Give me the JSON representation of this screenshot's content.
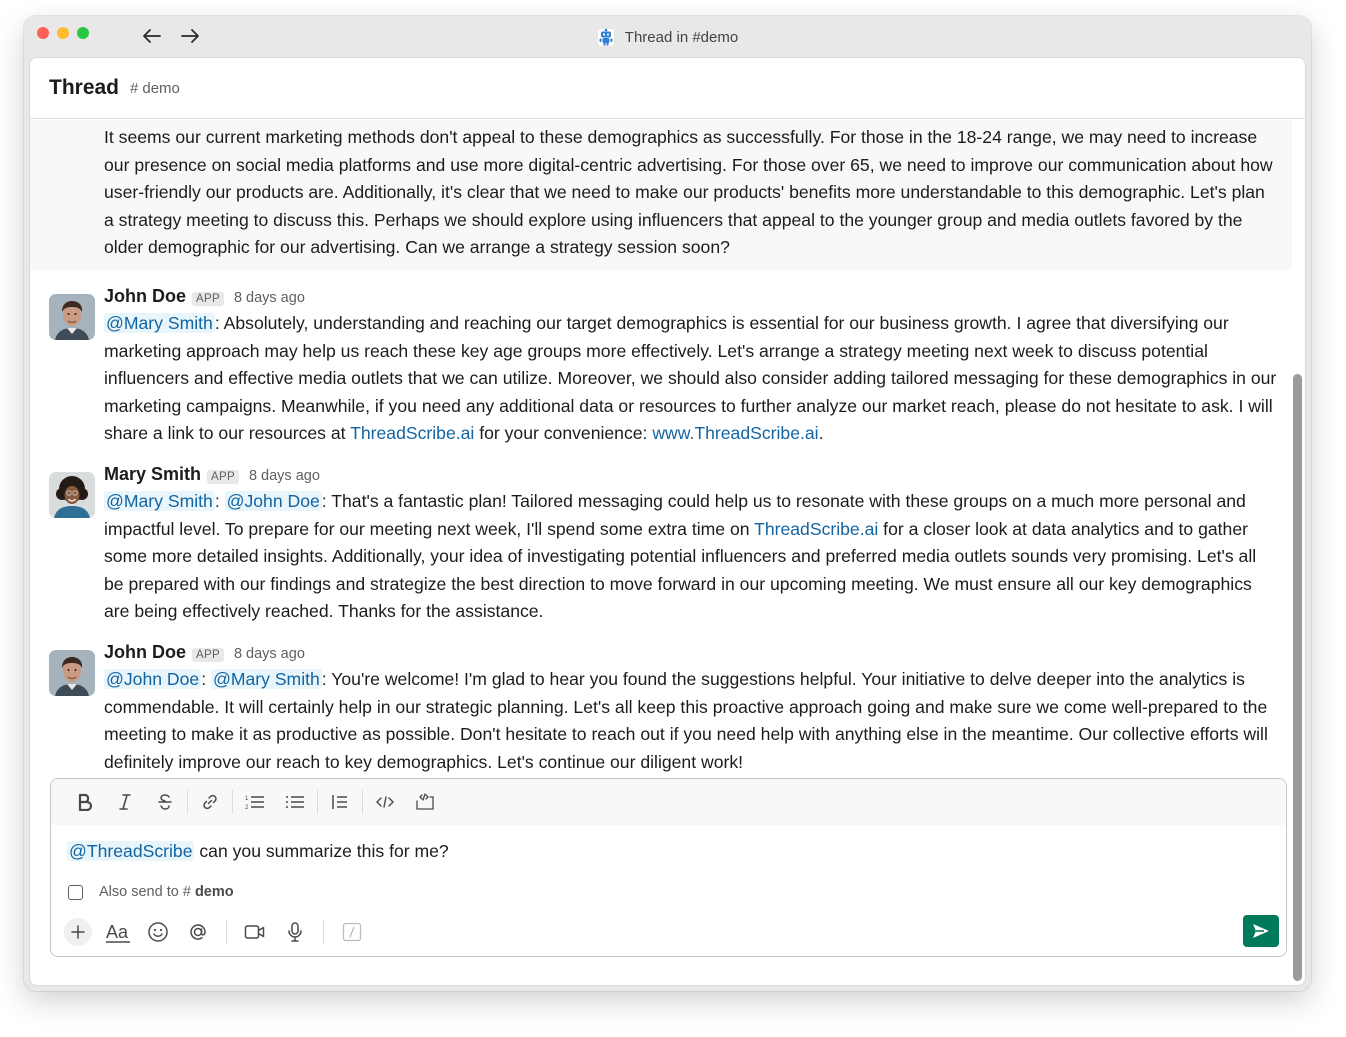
{
  "window": {
    "title": "Thread in #demo"
  },
  "header": {
    "title": "Thread",
    "channel_hash": "#",
    "channel": "demo"
  },
  "messages": [
    {
      "id": "m0",
      "highlighted": true,
      "text": "It seems our current marketing methods don't appeal to these demographics as successfully. For those in the 18-24 range, we may need to increase our presence on social media platforms and use more digital-centric advertising. For those over 65, we need to improve our communication about how user-friendly our products are. Additionally, it's clear that we need to make our products' benefits more understandable to this demographic. Let's plan a strategy meeting to discuss this. Perhaps we should explore using influencers that appeal to the younger group and media outlets favored by the older demographic for our advertising. Can we arrange a strategy session soon?"
    },
    {
      "id": "m1",
      "sender": "John Doe",
      "badge": "APP",
      "time": "8 days ago",
      "mentions": [
        "@Mary Smith"
      ],
      "text_before_link": ": Absolutely, understanding and reaching our target demographics is essential for our business growth. I agree that diversifying our marketing approach may help us reach these key age groups more effectively. Let's arrange a strategy meeting next week to discuss potential influencers and effective media outlets that we can utilize. Moreover, we should also consider adding tailored messaging for these demographics in our marketing campaigns. Meanwhile, if you need any additional data or resources to further analyze our market reach, please do not hesitate to ask. I will share a link to our resources at ",
      "link1": "ThreadScribe.ai",
      "text_mid": " for your convenience: ",
      "link2": "www.ThreadScribe.ai",
      "text_end": "."
    },
    {
      "id": "m2",
      "sender": "Mary Smith",
      "badge": "APP",
      "time": "8 days ago",
      "mentions": [
        "@Mary Smith",
        "@John Doe"
      ],
      "sep": ": ",
      "text_before_link": ": That's a fantastic plan! Tailored messaging could help us to resonate with these groups on a much more personal and impactful level. To prepare for our meeting next week, I'll spend some extra time on ",
      "link1": "ThreadScribe.ai",
      "text_end": " for a closer look at data analytics and to gather some more detailed insights. Additionally, your idea of investigating potential influencers and preferred media outlets sounds very promising. Let's all be prepared with our findings and strategize the best direction to move forward in our upcoming meeting. We must ensure all our key demographics are being effectively reached. Thanks for the assistance."
    },
    {
      "id": "m3",
      "sender": "John Doe",
      "badge": "APP",
      "time": "8 days ago",
      "mentions": [
        "@John Doe",
        "@Mary Smith"
      ],
      "sep": ": ",
      "text": ": You're welcome! I'm glad to hear you found the suggestions helpful. Your initiative to delve deeper into the analytics is commendable. It will certainly help in our strategic planning. Let's all keep this proactive approach going and make sure we come well-prepared to the meeting to make it as productive as possible. Don't hesitate to reach out if you need help with anything else in the meantime. Our collective efforts will definitely improve our reach to key demographics. Let's continue our diligent work!"
    }
  ],
  "composer": {
    "mention": "@ThreadScribe",
    "text": " can you summarize this for me?",
    "also_send_label": "Also send to",
    "also_send_hash": "#",
    "also_send_channel": "demo",
    "also_send_checked": false,
    "format_buttons": [
      "bold",
      "italic",
      "strikethrough",
      "link",
      "ordered-list",
      "bulleted-list",
      "blockquote",
      "code",
      "code-block"
    ],
    "action_buttons": [
      "attach",
      "formatting",
      "emoji",
      "mention",
      "video",
      "audio",
      "shortcuts"
    ]
  },
  "colors": {
    "accent_link": "#1264a3",
    "mention_bg": "#e8f5fa",
    "send_button": "#007a5a"
  }
}
